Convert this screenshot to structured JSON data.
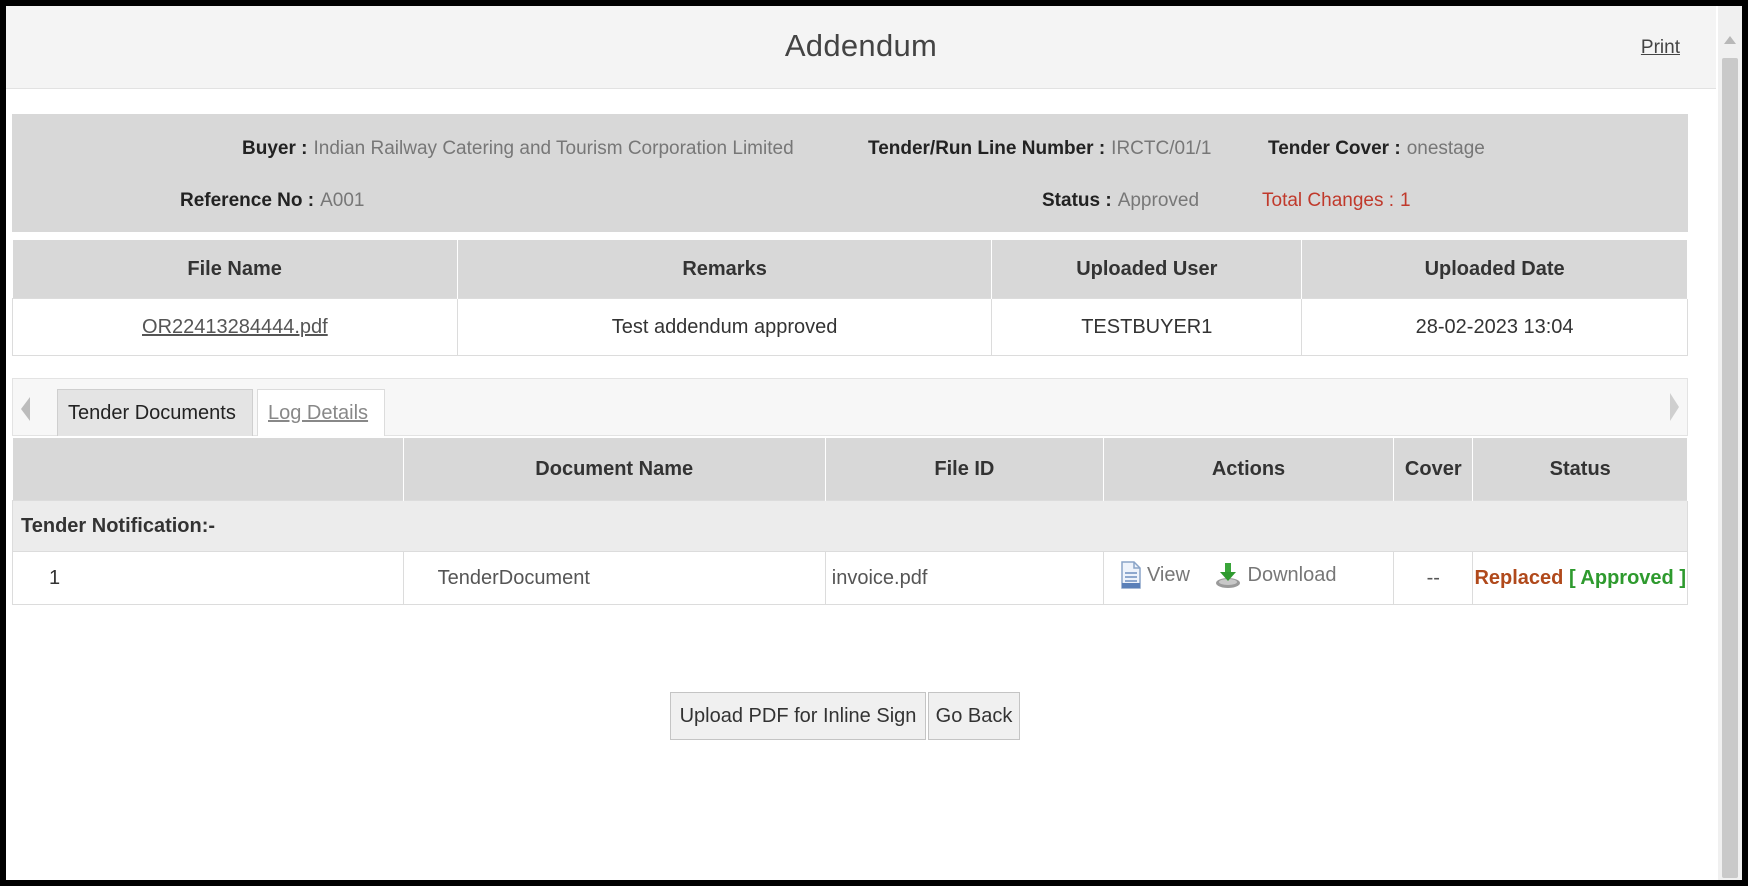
{
  "header": {
    "title": "Addendum",
    "print_label": "Print"
  },
  "info": {
    "buyer_label": "Buyer :",
    "buyer_value": "Indian Railway Catering and Tourism Corporation Limited",
    "tender_label": "Tender/Run Line Number :",
    "tender_value": "IRCTC/01/1",
    "cover_label": "Tender Cover :",
    "cover_value": "onestage",
    "reference_label": "Reference No :",
    "reference_value": "A001",
    "status_label": "Status :",
    "status_value": "Approved",
    "changes_label": "Total Changes :",
    "changes_value": "1"
  },
  "addendum_table": {
    "headers": [
      "File Name",
      "Remarks",
      "Uploaded User",
      "Uploaded Date"
    ],
    "rows": [
      {
        "file_name": "OR22413284444.pdf",
        "remarks": "Test addendum approved",
        "user": "TESTBUYER1",
        "date": "28-02-2023 13:04"
      }
    ]
  },
  "tabs": [
    {
      "label": "Tender Documents",
      "active": true
    },
    {
      "label": "Log Details",
      "active": false
    }
  ],
  "docs_table": {
    "headers": [
      "",
      "Document Name",
      "File ID",
      "Actions",
      "Cover",
      "Status"
    ],
    "section_label": "Tender Notification:-",
    "rows": [
      {
        "num": "1",
        "doc_name": "TenderDocument",
        "file_id": "invoice.pdf",
        "view_label": "View",
        "download_label": "Download",
        "cover": "--",
        "status_replaced": "Replaced",
        "status_open": " [ ",
        "status_approved": "Approved",
        "status_close": " ]"
      }
    ]
  },
  "buttons": {
    "upload_label": "Upload PDF for Inline Sign",
    "back_label": "Go Back"
  },
  "colors": {
    "panel_gray": "#d8d8d8",
    "replaced": "#b0491b",
    "approved": "#2e9a2e",
    "changes_red": "#c0392b"
  }
}
